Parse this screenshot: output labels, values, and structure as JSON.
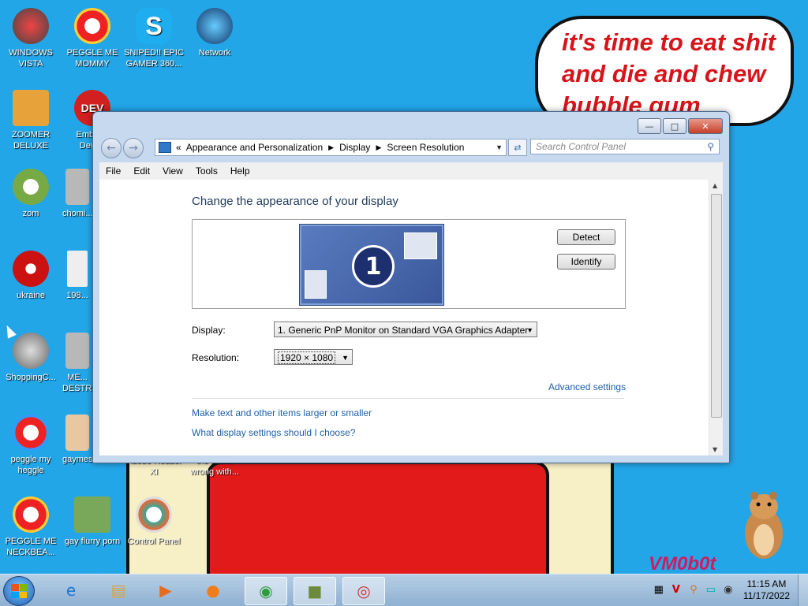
{
  "desktop": {
    "speech_bubble": "it's time to eat shit and die and chew bubble gum",
    "watermark": "VM0b0t",
    "icons": [
      {
        "label": "WINDOWS VISTA"
      },
      {
        "label": "PEGGLE ME MOMMY"
      },
      {
        "label": "SNIPED!! EPIC GAMER 360..."
      },
      {
        "label": "Network"
      },
      {
        "label": "ZOOMER DELUXE"
      },
      {
        "label": "Embar... Dev-..."
      },
      {
        "label": "zom"
      },
      {
        "label": "chomi..."
      },
      {
        "label": "ukraine"
      },
      {
        "label": "198..."
      },
      {
        "label": "ShoppingC..."
      },
      {
        "label": "ME... DESTR..."
      },
      {
        "label": "peggle my heggle"
      },
      {
        "label": "gaymes"
      },
      {
        "label": "Adobe Reader XI"
      },
      {
        "label": "the hell is wrong with..."
      },
      {
        "label": "PEGGLE ME NECKBEA..."
      },
      {
        "label": "gay flurry porn"
      },
      {
        "label": "Control Panel"
      }
    ]
  },
  "window": {
    "breadcrumb": [
      "Appearance and Personalization",
      "Display",
      "Screen Resolution"
    ],
    "search_placeholder": "Search Control Panel",
    "menu": [
      "File",
      "Edit",
      "View",
      "Tools",
      "Help"
    ],
    "heading": "Change the appearance of your display",
    "monitor_number": "1",
    "detect_button": "Detect",
    "identify_button": "Identify",
    "display_label": "Display:",
    "display_value": "1. Generic PnP Monitor on Standard VGA Graphics Adapter",
    "resolution_label": "Resolution:",
    "resolution_value": "1920 × 1080",
    "advanced_link": "Advanced settings",
    "link_text_size": "Make text and other items larger or smaller",
    "link_help": "What display settings should I choose?"
  },
  "taskbar": {
    "time": "11:15 AM",
    "date": "11/17/2022"
  },
  "colors": {
    "desktop_bg": "#22a6e8",
    "link": "#1e5fab",
    "heading": "#1e395b"
  }
}
